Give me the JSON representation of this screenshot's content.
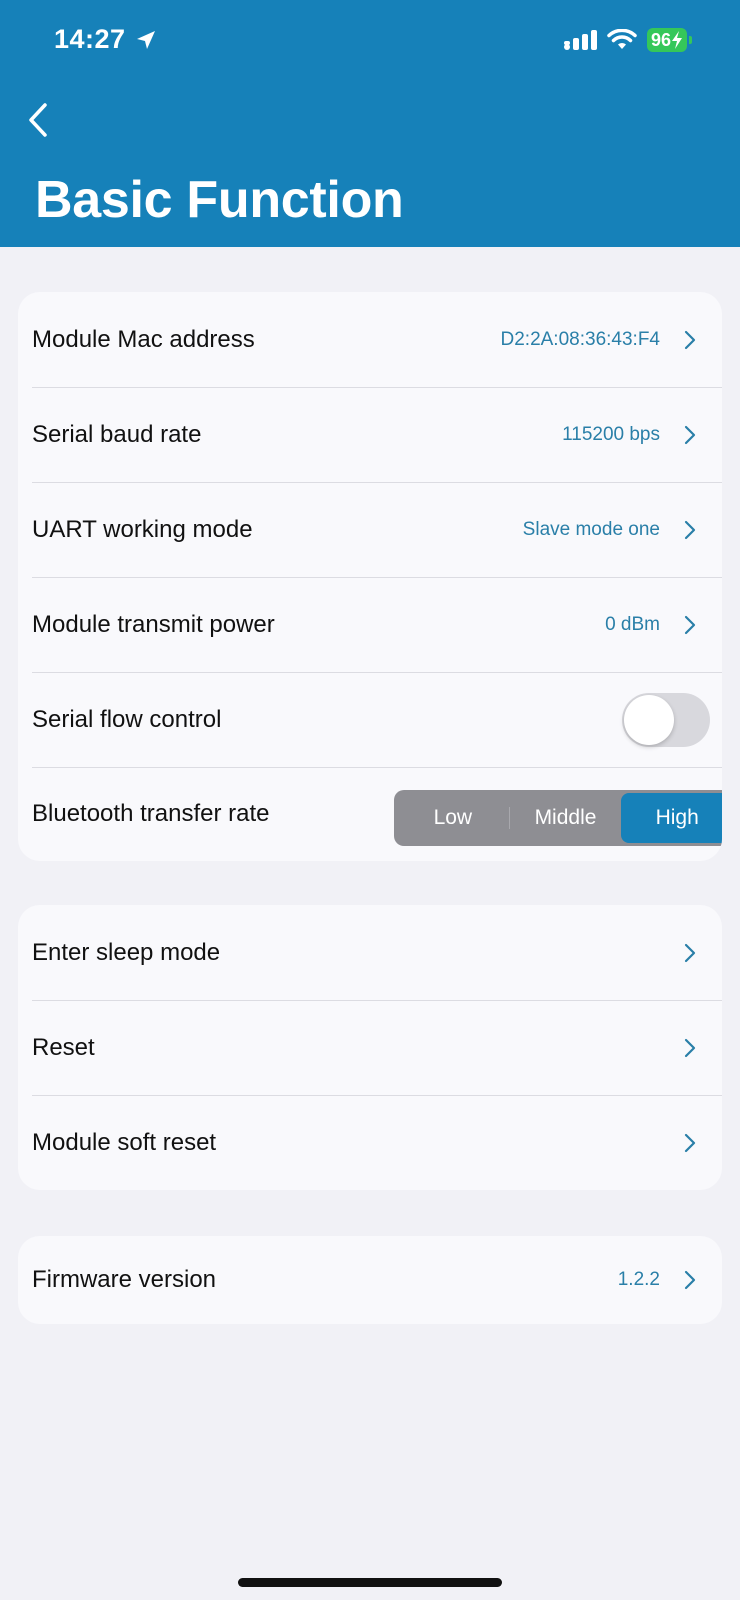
{
  "status_bar": {
    "time": "14:27",
    "battery": "96",
    "icons": [
      "location-arrow-icon",
      "signal-icon",
      "wifi-icon",
      "battery-charging-icon"
    ]
  },
  "header": {
    "title": "Basic Function",
    "background": "#1681b9"
  },
  "group1": {
    "rows": [
      {
        "label": "Module Mac address",
        "value": "D2:2A:08:36:43:F4"
      },
      {
        "label": "Serial baud rate",
        "value": "115200 bps"
      },
      {
        "label": "UART working mode",
        "value": "Slave mode one"
      },
      {
        "label": "Module transmit power",
        "value": "0 dBm"
      }
    ],
    "flow_control": {
      "label": "Serial flow control",
      "enabled": false
    },
    "transfer_rate": {
      "label": "Bluetooth transfer rate",
      "options": [
        "Low",
        "Middle",
        "High"
      ],
      "selected": "High"
    }
  },
  "group2": {
    "rows": [
      {
        "label": "Enter sleep mode"
      },
      {
        "label": "Reset"
      },
      {
        "label": "Module soft reset"
      }
    ]
  },
  "group3": {
    "rows": [
      {
        "label": "Firmware version",
        "value": "1.2.2"
      }
    ]
  },
  "colors": {
    "accent": "#1681b9",
    "value_text": "#2a7fa8",
    "background": "#f1f1f6"
  }
}
